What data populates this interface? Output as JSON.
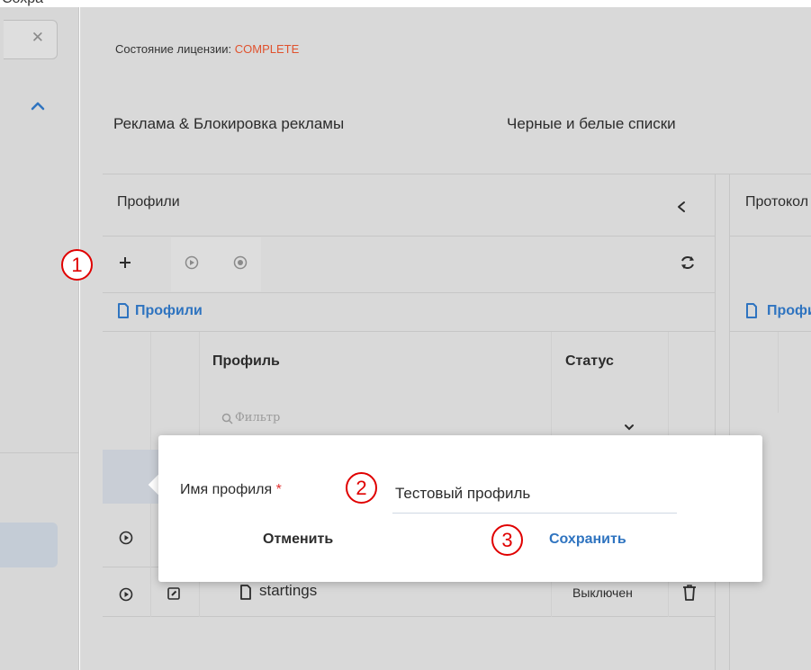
{
  "top_cut_text": "Сохра",
  "sidebar": {
    "close_icon": "close-icon",
    "chevron_icon": "chevron-up-icon"
  },
  "license": {
    "label": "Состояние лицензии:",
    "value": "COMPLETE",
    "value_color": "#e0522e"
  },
  "tabs": [
    {
      "label": "Реклама & Блокировка рекламы"
    },
    {
      "label": "Черные и белые списки"
    }
  ],
  "left_panel": {
    "title": "Профили",
    "collapse_icon": "chevron-left-icon",
    "toolbar": {
      "add_label": "+",
      "play_icon": "play-icon",
      "stop_icon": "stop-icon",
      "refresh_icon": "refresh-icon"
    },
    "breadcrumb": "Профили",
    "columns": {
      "profile": "Профиль",
      "status": "Статус"
    },
    "filter_placeholder": "Фильтр",
    "rows": [
      {
        "name": "startings",
        "status": "Выключен"
      }
    ]
  },
  "right_panel": {
    "title": "Протокол",
    "breadcrumb": "Профили"
  },
  "popover": {
    "label": "Имя профиля",
    "required_mark": "*",
    "value": "Тестовый профиль",
    "cancel_label": "Отменить",
    "save_label": "Сохранить"
  },
  "steps": [
    "1",
    "2",
    "3"
  ],
  "colors": {
    "accent": "#2f74c0",
    "license": "#e0522e",
    "step_marker": "#e00000"
  }
}
